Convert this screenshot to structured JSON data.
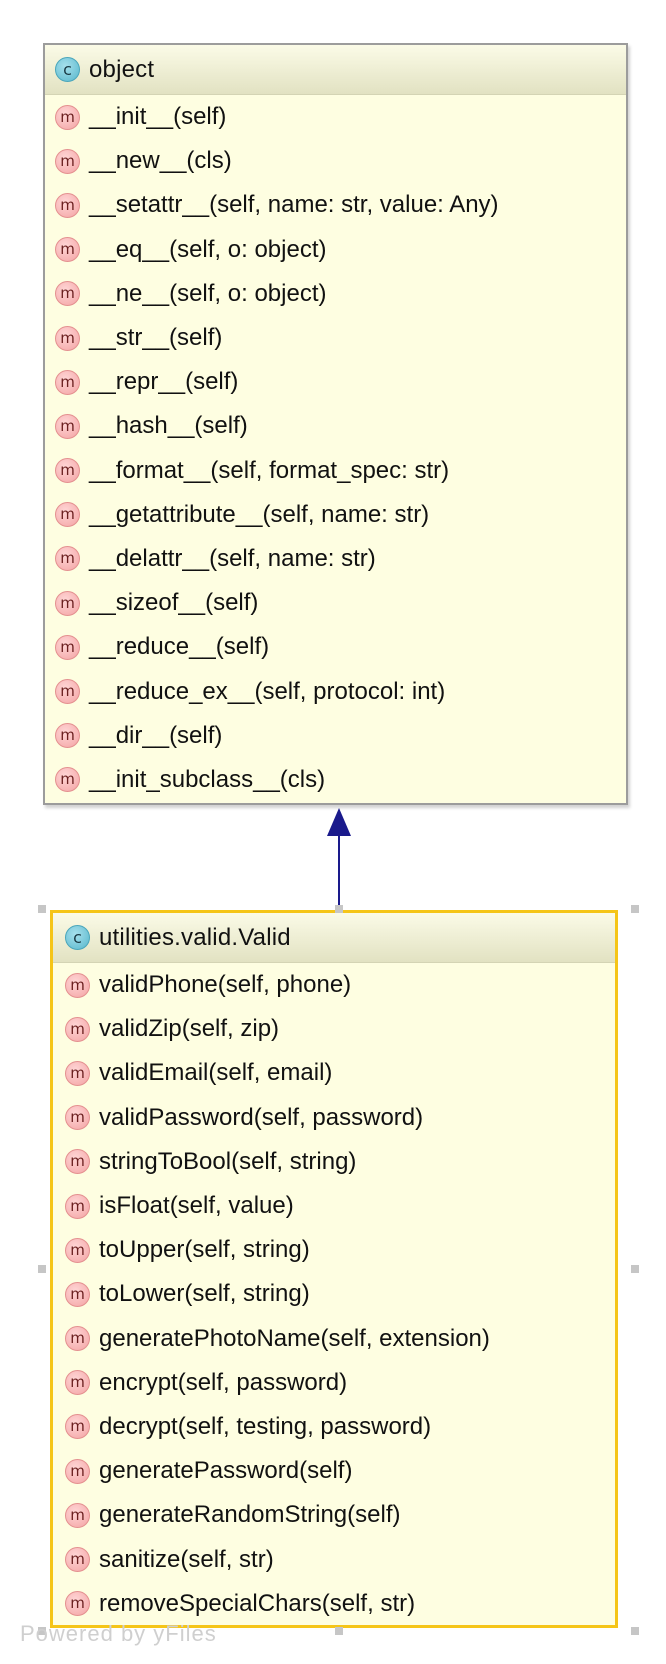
{
  "diagram": {
    "parent_class": {
      "name": "object",
      "badge": "c",
      "methods": [
        "__init__(self)",
        "__new__(cls)",
        "__setattr__(self, name: str, value: Any)",
        "__eq__(self, o: object)",
        "__ne__(self, o: object)",
        "__str__(self)",
        "__repr__(self)",
        "__hash__(self)",
        "__format__(self, format_spec: str)",
        "__getattribute__(self, name: str)",
        "__delattr__(self, name: str)",
        "__sizeof__(self)",
        "__reduce__(self)",
        "__reduce_ex__(self, protocol: int)",
        "__dir__(self)",
        "__init_subclass__(cls)"
      ]
    },
    "child_class": {
      "name": "utilities.valid.Valid",
      "badge": "c",
      "selected": true,
      "methods": [
        "validPhone(self, phone)",
        "validZip(self, zip)",
        "validEmail(self, email)",
        "validPassword(self, password)",
        "stringToBool(self, string)",
        "isFloat(self, value)",
        "toUpper(self, string)",
        "toLower(self, string)",
        "generatePhotoName(self, extension)",
        "encrypt(self, password)",
        "decrypt(self, testing, password)",
        "generatePassword(self)",
        "generateRandomString(self)",
        "sanitize(self, str)",
        "removeSpecialChars(self, str)"
      ]
    },
    "method_badge": "m",
    "relation": "inheritance",
    "watermark": "Powered by yFiles",
    "colors": {
      "box_fill": "#fefee1",
      "selection_border": "#f5c518",
      "arrow": "#1a1a8c",
      "class_badge": "#58b7cc",
      "method_badge": "#f3a3a3"
    }
  }
}
